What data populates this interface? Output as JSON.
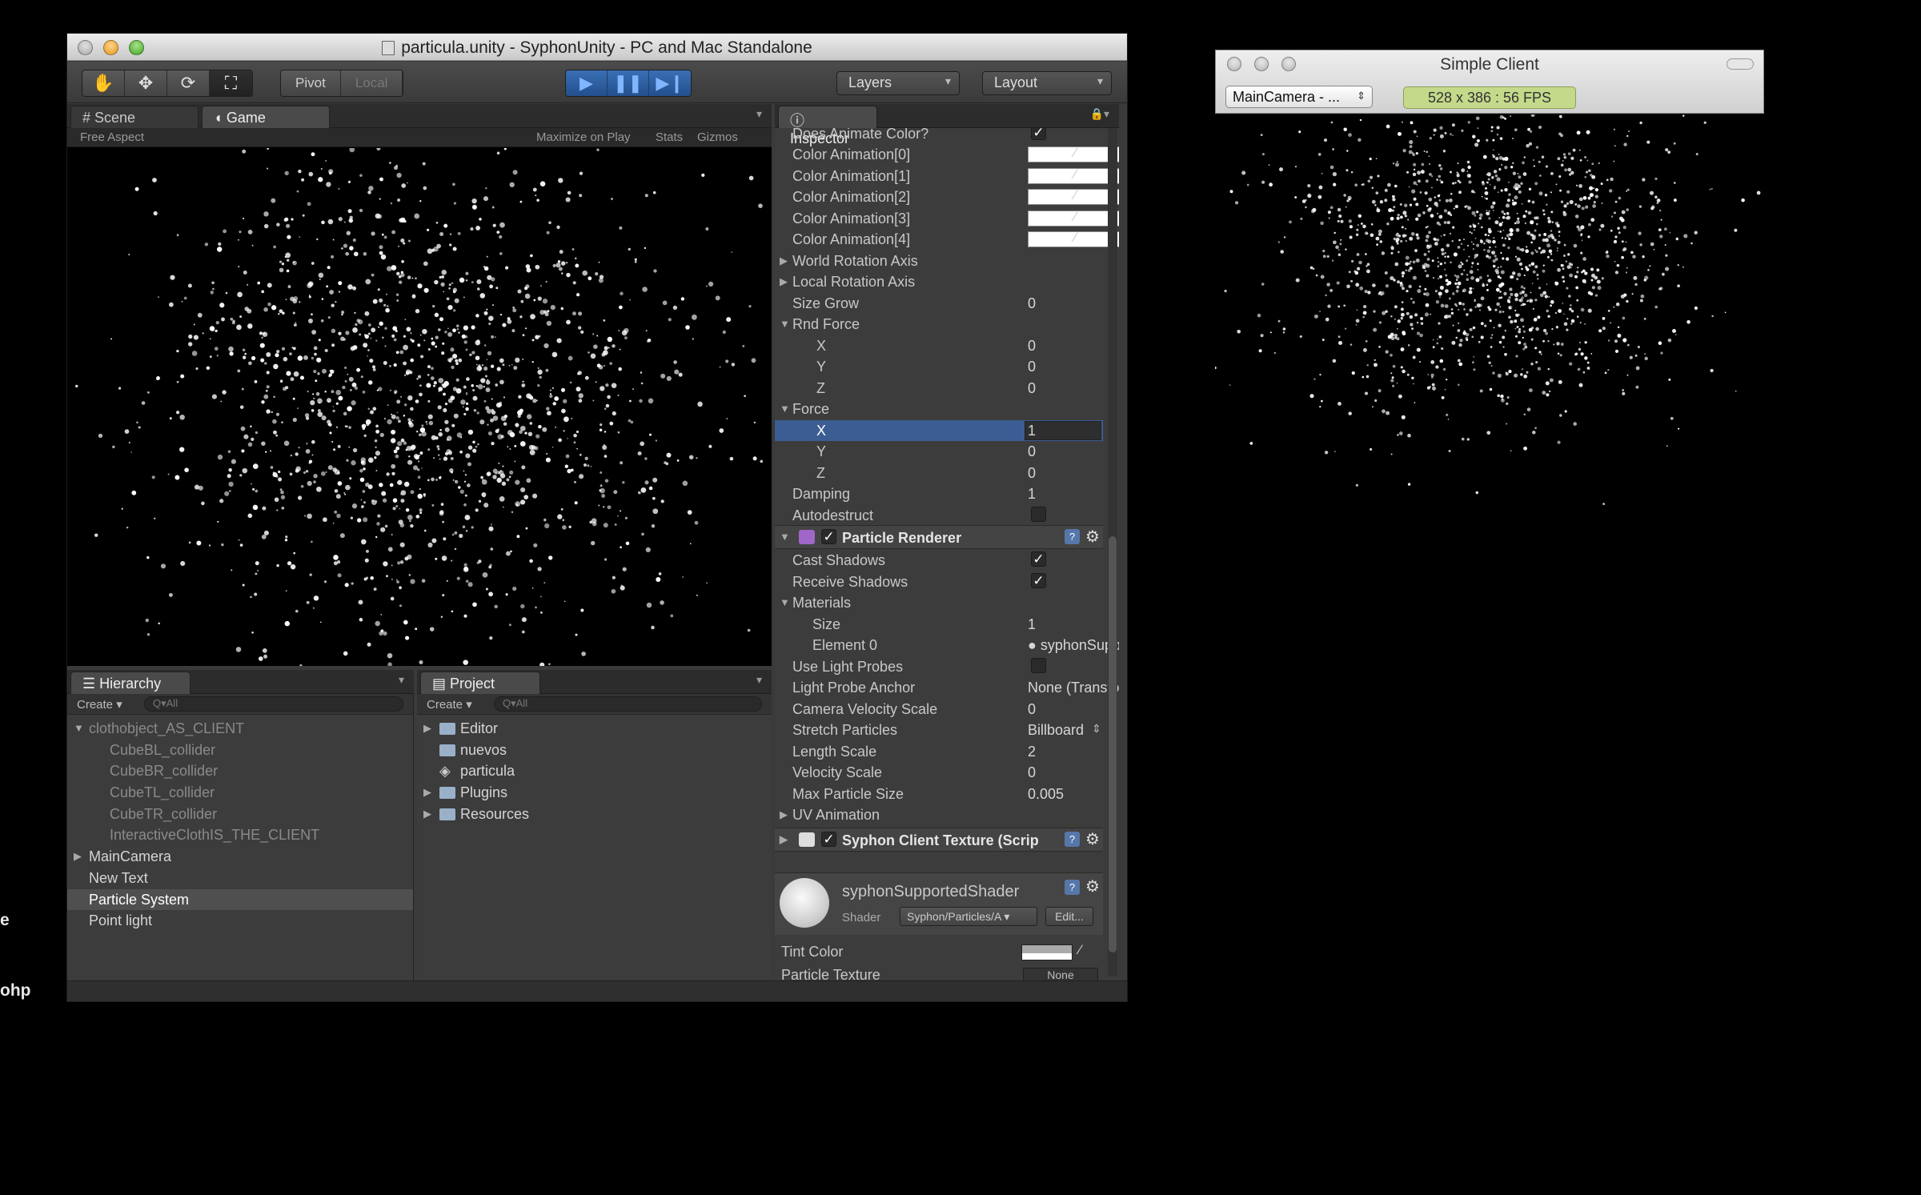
{
  "unity": {
    "title": "particula.unity - SyphonUnity - PC and Mac Standalone",
    "toolbar": {
      "pivot": "Pivot",
      "local": "Local",
      "layers": "Layers",
      "layout": "Layout"
    },
    "game_tabs": {
      "scene": "Scene",
      "game": "Game"
    },
    "game_toolbar": {
      "aspect": "Free Aspect",
      "maximize": "Maximize on Play",
      "stats": "Stats",
      "gizmos": "Gizmos"
    },
    "hierarchy": {
      "tab": "Hierarchy",
      "create": "Create",
      "search_placeholder": "Q▾All",
      "items": [
        {
          "label": "clothobject_AS_CLIENT",
          "dim": true,
          "expanded": true
        },
        {
          "label": "CubeBL_collider",
          "dim": true
        },
        {
          "label": "CubeBR_collider",
          "dim": true
        },
        {
          "label": "CubeTL_collider",
          "dim": true
        },
        {
          "label": "CubeTR_collider",
          "dim": true
        },
        {
          "label": "InteractiveClothIS_THE_CLIENT",
          "dim": true
        },
        {
          "label": "MainCamera",
          "collapsed": true
        },
        {
          "label": "New Text"
        },
        {
          "label": "Particle System",
          "selected": true
        },
        {
          "label": "Point light"
        }
      ]
    },
    "project": {
      "tab": "Project",
      "create": "Create",
      "search_placeholder": "Q▾All",
      "items": [
        {
          "label": "Editor",
          "type": "folder"
        },
        {
          "label": "nuevos",
          "type": "folder"
        },
        {
          "label": "particula",
          "type": "scene"
        },
        {
          "label": "Plugins",
          "type": "folder"
        },
        {
          "label": "Resources",
          "type": "folder"
        }
      ]
    },
    "inspector": {
      "tab": "Inspector",
      "props": {
        "does_animate_color": "Does Animate Color?",
        "color_anim_0": "Color Animation[0]",
        "color_anim_1": "Color Animation[1]",
        "color_anim_2": "Color Animation[2]",
        "color_anim_3": "Color Animation[3]",
        "color_anim_4": "Color Animation[4]",
        "world_rotation_axis": "World Rotation Axis",
        "local_rotation_axis": "Local Rotation Axis",
        "size_grow": "Size Grow",
        "size_grow_val": "0",
        "rnd_force": "Rnd Force",
        "x": "X",
        "y": "Y",
        "z": "Z",
        "rnd_x": "0",
        "rnd_y": "0",
        "rnd_z": "0",
        "force": "Force",
        "force_x": "1",
        "force_y": "0",
        "force_z": "0",
        "damping": "Damping",
        "damping_val": "1",
        "autodestruct": "Autodestruct"
      },
      "renderer": {
        "header": "Particle Renderer",
        "cast_shadows": "Cast Shadows",
        "receive_shadows": "Receive Shadows",
        "materials": "Materials",
        "size": "Size",
        "size_val": "1",
        "element0": "Element 0",
        "element0_val": "syphonSuppor",
        "use_light_probes": "Use Light Probes",
        "light_probe_anchor": "Light Probe Anchor",
        "light_probe_anchor_val": "None (Transform)",
        "camera_velocity_scale": "Camera Velocity Scale",
        "camera_velocity_scale_val": "0",
        "stretch_particles": "Stretch Particles",
        "stretch_particles_val": "Billboard",
        "length_scale": "Length Scale",
        "length_scale_val": "2",
        "velocity_scale": "Velocity Scale",
        "velocity_scale_val": "0",
        "max_particle_size": "Max Particle Size",
        "max_particle_size_val": "0.005",
        "uv_animation": "UV Animation"
      },
      "syphon": {
        "header": "Syphon Client Texture (Scrip"
      },
      "material": {
        "name": "syphonSupportedShader",
        "shader_label": "Shader",
        "shader_value": "Syphon/Particles/A",
        "edit": "Edit...",
        "tint_color": "Tint Color",
        "particle_texture": "Particle Texture",
        "particle_texture_val": "None"
      }
    }
  },
  "client": {
    "title": "Simple Client",
    "camera_select": "MainCamera - ...",
    "fps": "528 x 386 : 56 FPS"
  },
  "edge_text": {
    "a": "e",
    "b": "ohp"
  },
  "colors": {
    "unity_bg": "#3a3a3a",
    "selection_blue": "#3b5d93",
    "play_blue": "#2f62a6",
    "fps_green": "#c4d98a"
  }
}
